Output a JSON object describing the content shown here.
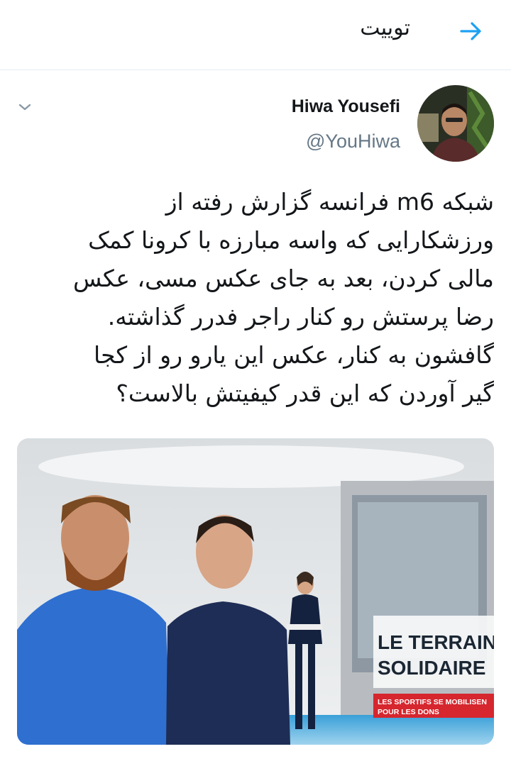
{
  "header": {
    "title": "توییت",
    "back_icon": "arrow-right-icon",
    "accent_color": "#1da1f2"
  },
  "tweet": {
    "author_name": "Hiwa Yousefi",
    "author_handle": "@YouHiwa",
    "menu_icon": "chevron-down-icon",
    "text_lines": [
      "شبکه m6 فرانسه گزارش رفته از",
      "ورزشکارایی که واسه مبارزه با کرونا کمک",
      "مالی کردن، بعد به جای عکس مسی، عکس",
      "رضا پرستش رو کنار راجر فدرر گذاشته.",
      "گافشون به کنار، عکس این یارو رو از کجا",
      "گیر آوردن که این قدر کیفیتش بالاست؟"
    ]
  },
  "media": {
    "banner_title_line1": "LE TERRAIN",
    "banner_title_line2": "SOLIDAIRE",
    "ticker_line1": "LES SPORTIFS SE MOBILISEN",
    "ticker_line2": "POUR LES DONS"
  }
}
